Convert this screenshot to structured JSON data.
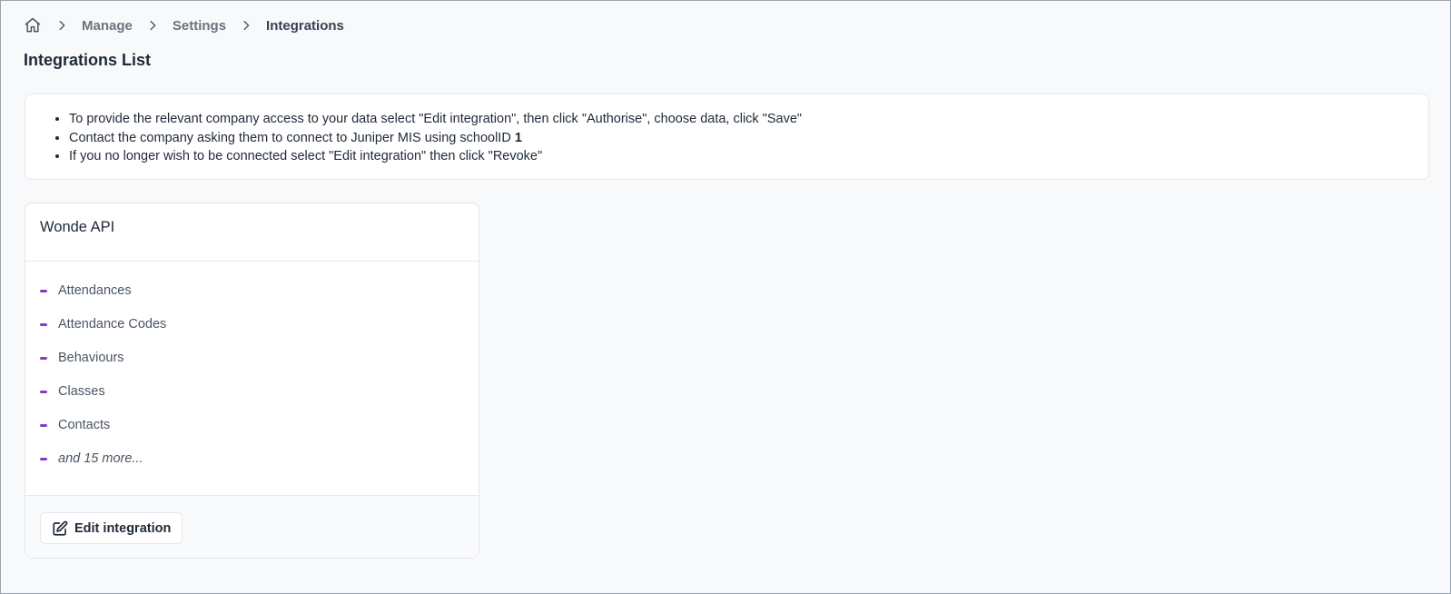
{
  "breadcrumb": {
    "home_icon": "home-icon",
    "separator_icon": "chevron-right-icon",
    "items": [
      "Manage",
      "Settings"
    ],
    "current": "Integrations"
  },
  "page": {
    "title": "Integrations List"
  },
  "info": {
    "line1": "To provide the relevant company access to your data select \"Edit integration\", then click \"Authorise\", choose data, click \"Save\"",
    "line2_prefix": "Contact the company asking them to connect to Juniper MIS using schoolID ",
    "line2_school_id": "1",
    "line3": "If you no longer wish to be connected select \"Edit integration\" then click \"Revoke\""
  },
  "integration": {
    "name": "Wonde API",
    "scopes": [
      "Attendances",
      "Attendance Codes",
      "Behaviours",
      "Classes",
      "Contacts"
    ],
    "more_label": "and 15 more...",
    "edit_label": "Edit integration",
    "edit_icon": "edit-square-icon"
  },
  "colors": {
    "accent": "#7e3fc8",
    "background": "#f8f9fb"
  }
}
